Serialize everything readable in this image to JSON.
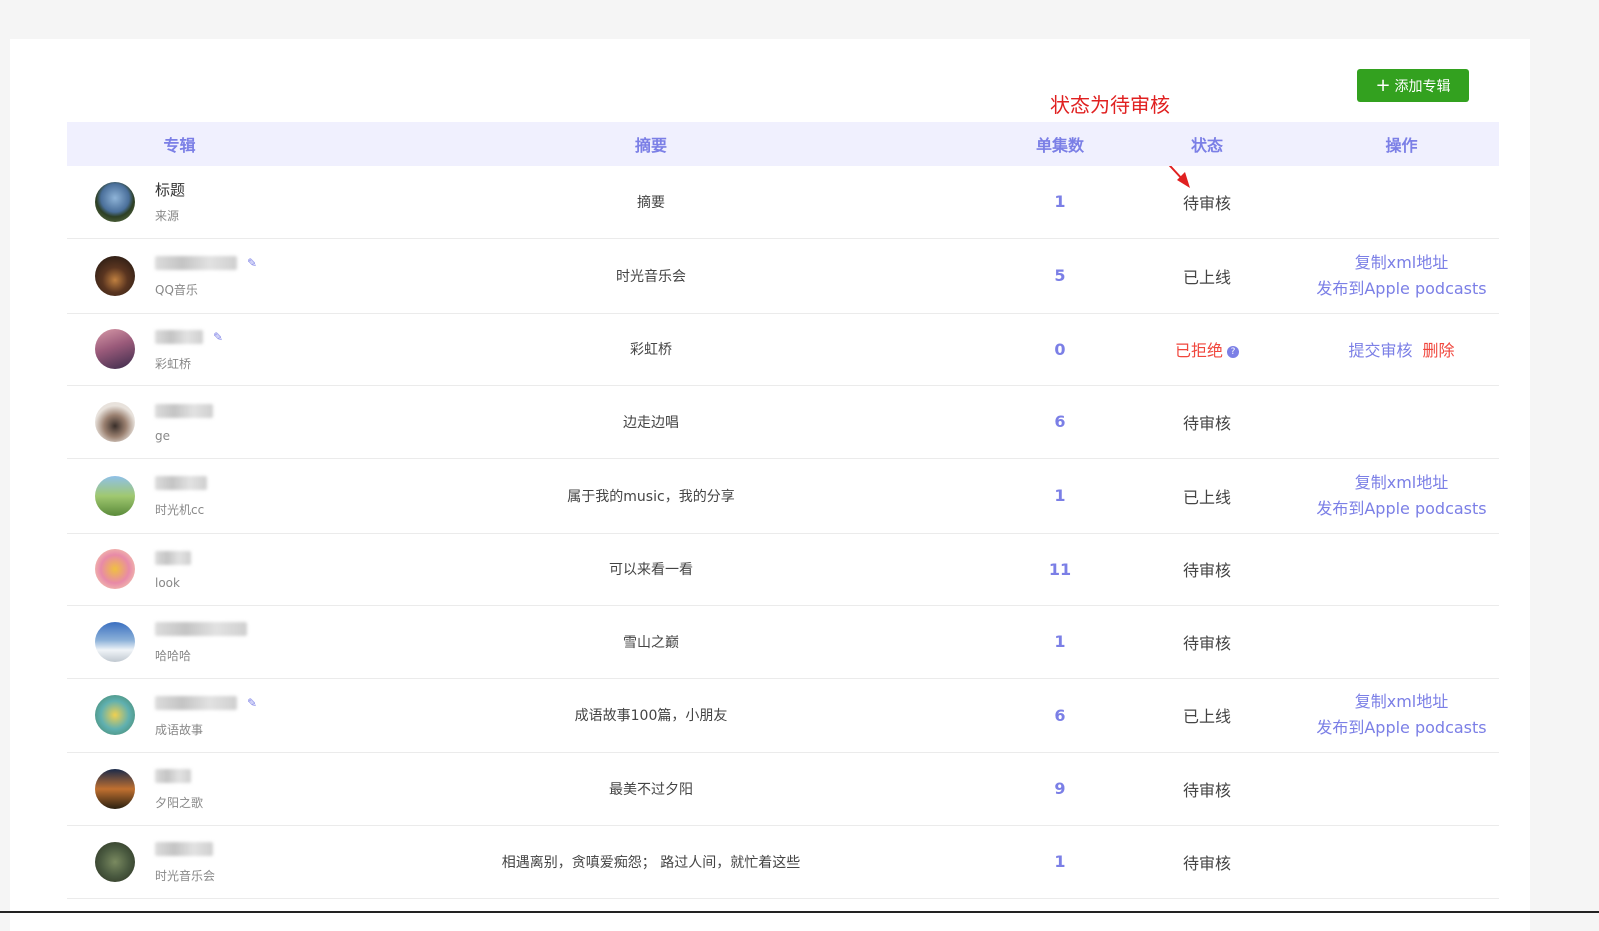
{
  "header": {
    "add_button": "添加专辑"
  },
  "annotation": "状态为待审核",
  "table": {
    "columns": [
      "专辑",
      "摘要",
      "单集数",
      "状态",
      "操作"
    ],
    "rows": [
      {
        "title": "标题",
        "source": "来源",
        "summary": "摘要",
        "count": "1",
        "status": "待审核",
        "status_type": "pending",
        "avatar": "landscape-lake",
        "ops": []
      },
      {
        "title_blurred": true,
        "source": "QQ音乐",
        "summary": "时光音乐会",
        "count": "5",
        "status": "已上线",
        "status_type": "online",
        "avatar": "concert-crowd",
        "ops": [
          "复制xml地址",
          "发布到Apple podcasts"
        ]
      },
      {
        "title_blurred": true,
        "source": "彩虹桥",
        "summary": "彩虹桥",
        "count": "0",
        "status": "已拒绝",
        "status_type": "rejected",
        "avatar": "bridge-sunset",
        "ops": [
          "提交审核",
          "删除"
        ]
      },
      {
        "title_blurred": true,
        "source": "ge",
        "summary": "边走边唱",
        "count": "6",
        "status": "待审核",
        "status_type": "pending",
        "avatar": "person-portrait",
        "ops": []
      },
      {
        "title_blurred": true,
        "source": "时光机cc",
        "summary": "属于我的music，我的分享",
        "count": "1",
        "status": "已上线",
        "status_type": "online",
        "avatar": "train-field",
        "ops": [
          "复制xml地址",
          "发布到Apple podcasts"
        ]
      },
      {
        "title_blurred": true,
        "source": "look",
        "summary": "可以来看一看",
        "count": "11",
        "status": "待审核",
        "status_type": "pending",
        "avatar": "smile-badge",
        "ops": []
      },
      {
        "title_blurred": true,
        "source": "哈哈哈",
        "summary": "雪山之巅",
        "count": "1",
        "status": "待审核",
        "status_type": "pending",
        "avatar": "snow-mountain",
        "ops": []
      },
      {
        "title_blurred": true,
        "source": "成语故事",
        "summary": "成语故事100篇，小朋友",
        "count": "6",
        "status": "已上线",
        "status_type": "online",
        "avatar": "cartoon-kids",
        "ops": [
          "复制xml地址",
          "发布到Apple podcasts"
        ]
      },
      {
        "title_blurred": true,
        "source": "夕阳之歌",
        "summary": "最美不过夕阳",
        "count": "9",
        "status": "待审核",
        "status_type": "pending",
        "avatar": "sunset-sky",
        "ops": []
      },
      {
        "title_blurred": true,
        "source": "时光音乐会",
        "summary": "相遇离别，贪嗔爱痴怨；  路过人间，就忙着这些",
        "count": "1",
        "status": "待审核",
        "status_type": "pending",
        "avatar": "nature-dark",
        "ops": []
      }
    ]
  }
}
